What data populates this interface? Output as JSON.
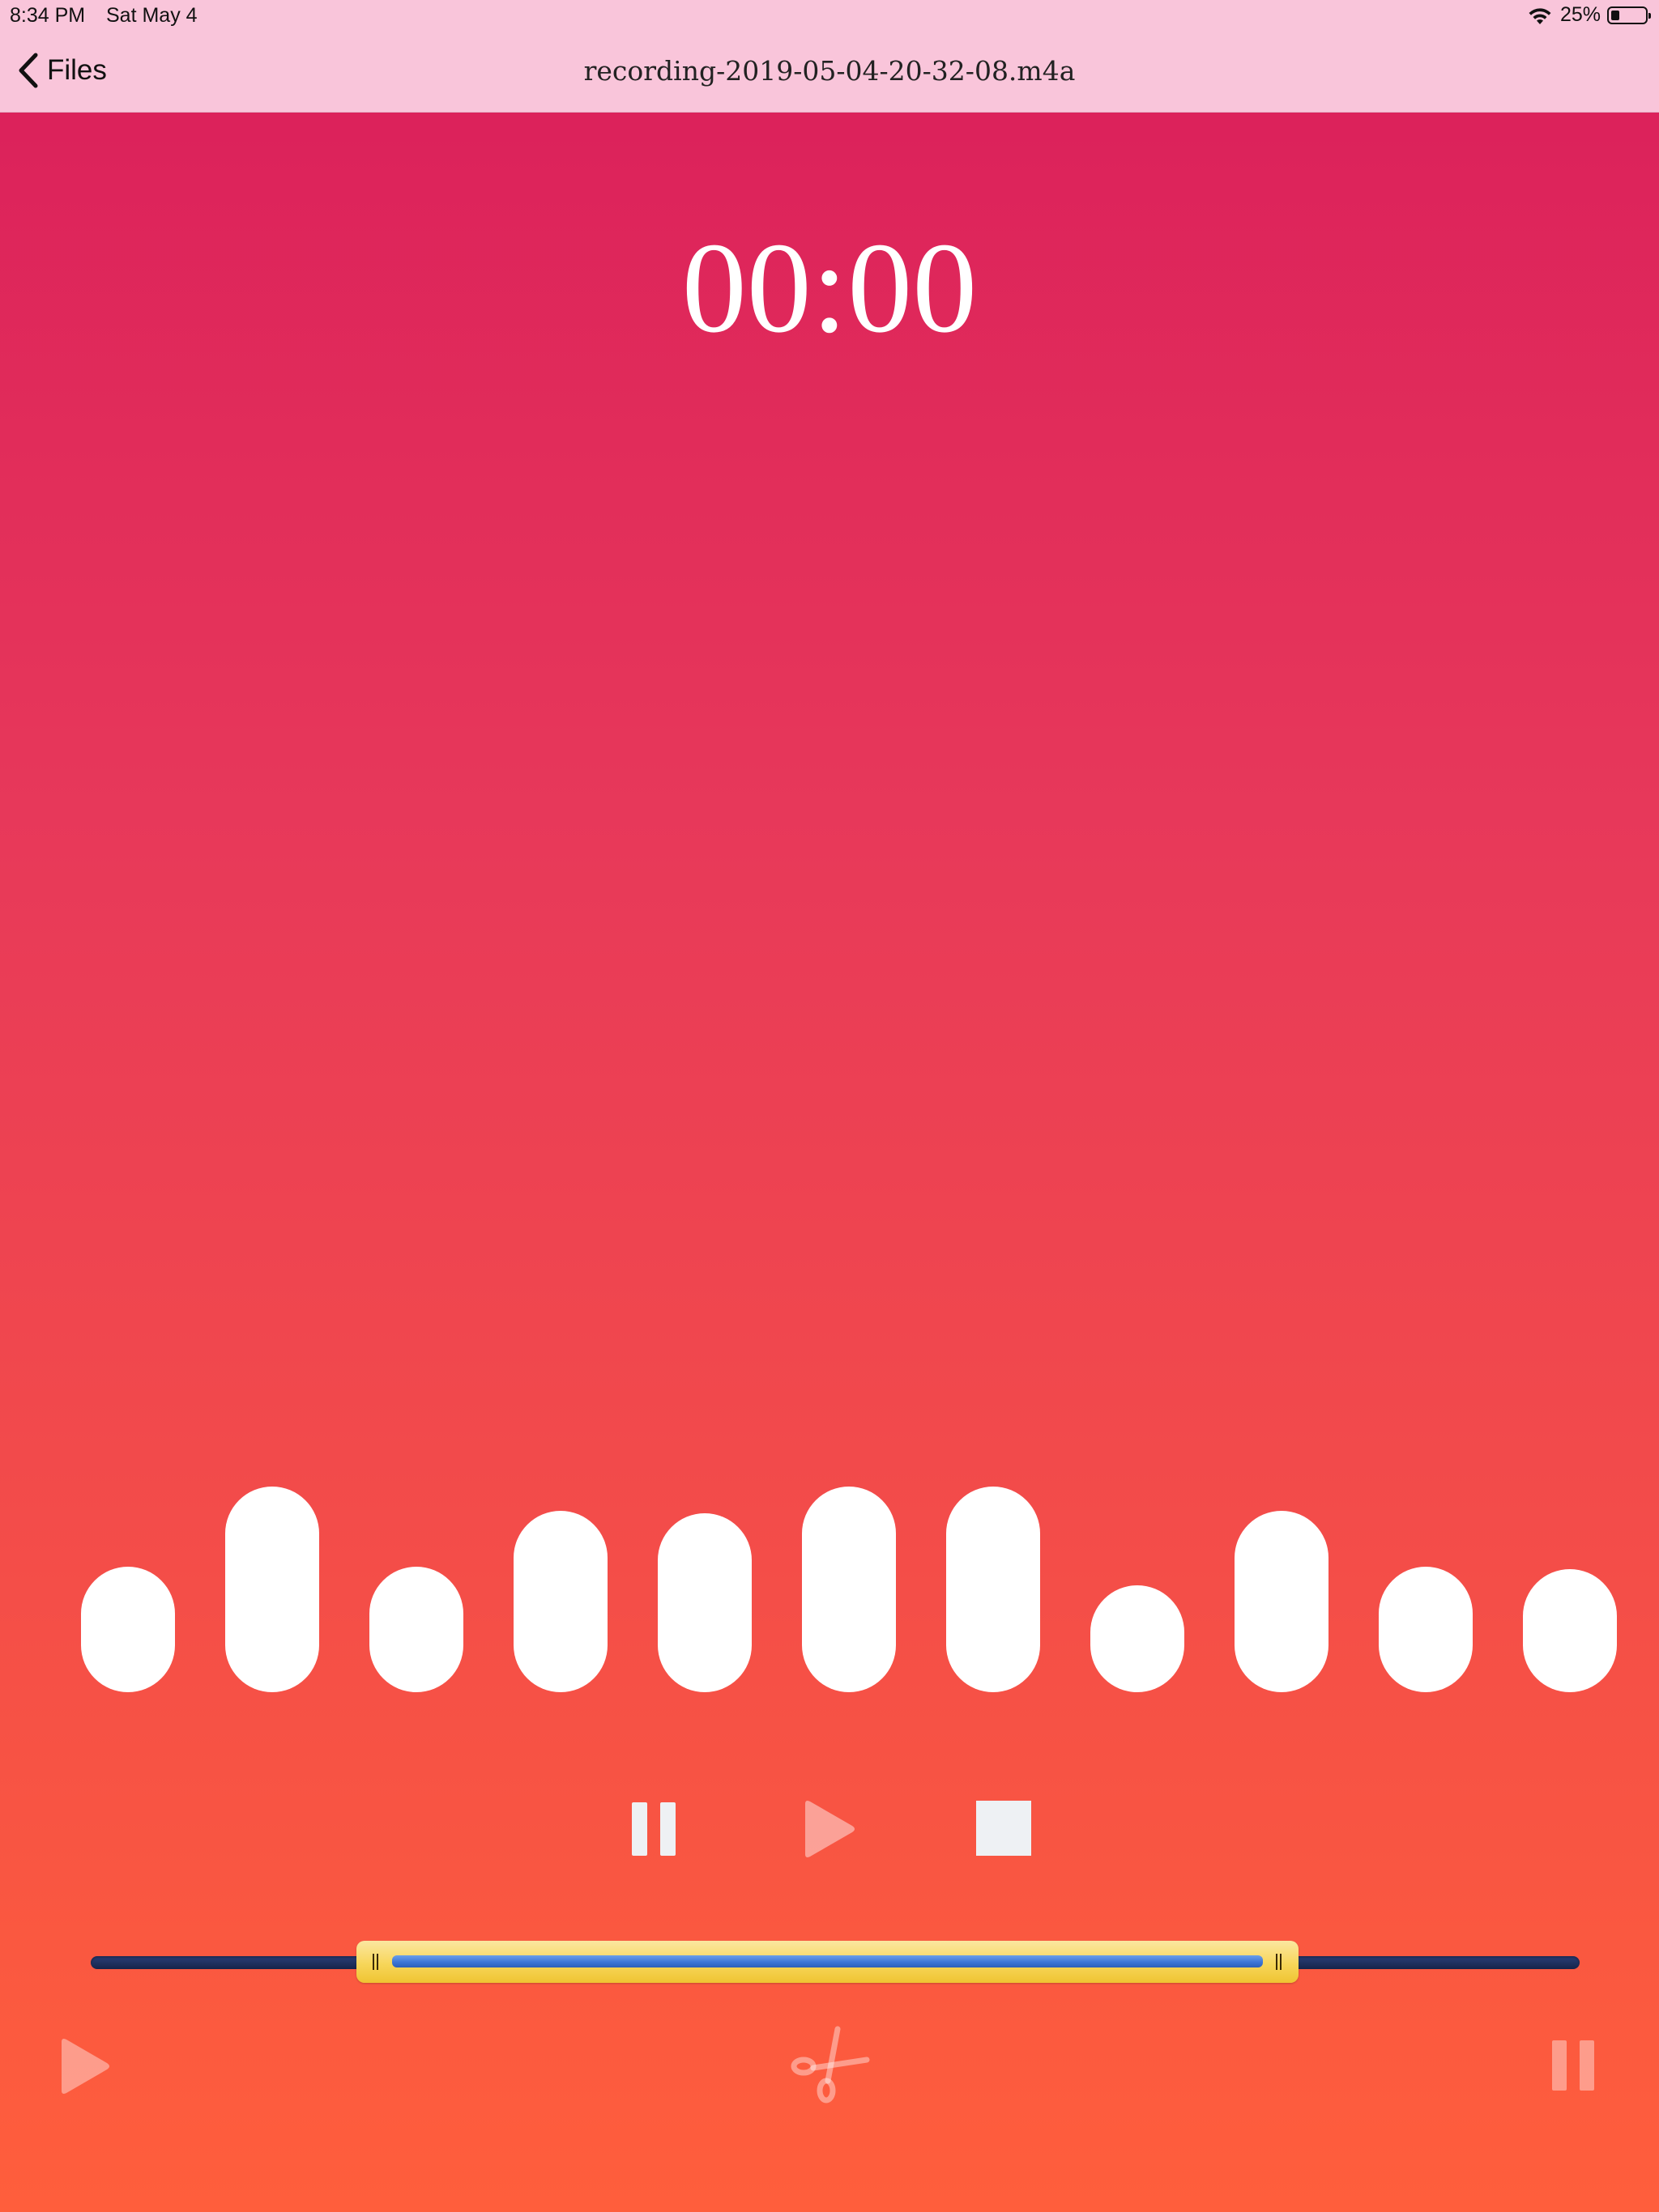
{
  "status_bar": {
    "time": "8:34 PM",
    "date": "Sat May 4",
    "battery_label": "25%",
    "battery_level": 0.25,
    "wifi_icon": "wifi-icon",
    "battery_icon": "battery-icon"
  },
  "nav": {
    "back_label": "Files",
    "back_icon": "chevron-left-icon",
    "title": "recording-2019-05-04-20-32-08.m4a"
  },
  "player": {
    "timer": "00:00"
  },
  "waveform": {
    "levels": [
      0.61,
      1.0,
      0.61,
      0.88,
      0.87,
      1.0,
      1.0,
      0.52,
      0.88,
      0.61,
      0.6
    ]
  },
  "controls": {
    "pause_icon": "pause-icon",
    "play_icon": "play-icon",
    "stop_icon": "stop-icon"
  },
  "trim": {
    "start": 0.195,
    "end": 0.795
  },
  "bottom_toolbar": {
    "play_icon": "play-icon",
    "scissors_icon": "scissors-icon",
    "pause_icon": "pause-icon"
  },
  "colors": {
    "nav_background": "#f9c5da",
    "gradient_top": "#da1e5b",
    "gradient_bottom": "#ff5e3c",
    "trim_selection": "#f7d65a",
    "trim_active": "#3b73d4",
    "trim_track": "#1e2f5c"
  }
}
